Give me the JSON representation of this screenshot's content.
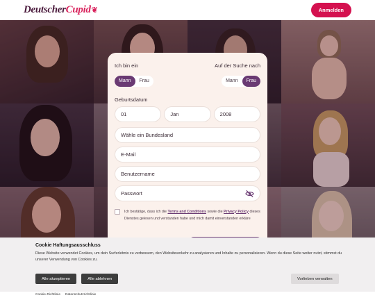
{
  "header": {
    "logo_part1": "Deutscher",
    "logo_part2": "Cupid",
    "login_label": "Anmelden"
  },
  "form": {
    "i_am_label": "Ich bin ein",
    "i_am_options": [
      "Mann",
      "Frau"
    ],
    "i_am_selected": "Mann",
    "seeking_label": "Auf der Suche nach",
    "seeking_options": [
      "Mann",
      "Frau"
    ],
    "seeking_selected": "Frau",
    "birthdate_label": "Geburtsdatum",
    "birth_day": "01",
    "birth_month": "Jan",
    "birth_year": "2008",
    "state_placeholder": "Wähle ein Bundesland",
    "email_placeholder": "E-Mail",
    "username_placeholder": "Benutzername",
    "password_placeholder": "Passwort",
    "consent_prefix": "Ich bestätige, dass ich die",
    "consent_terms_link": "Terms and Conditions",
    "consent_mid": "sowie die",
    "consent_privacy_link": "Privacy Policy",
    "consent_suffix": "dieses Dienstes gelesen und verstanden habe und mich damit einverstanden erkläre"
  },
  "cookie": {
    "title": "Cookie Haftungsausschluss",
    "text": "Diese Website verwendet Cookies, um dein Surferlebnis zu verbessern, den Websiteverkehr zu analysieren und Inhalte zu personalisieren. Wenn du diese Seite weiter nutzt, stimmst du unserer Verwendung von Cookies zu.",
    "accept_all": "Alle akzeptieren",
    "reject_all": "Alle ablehnen",
    "manage": "Vorlieben verwalten",
    "link_cookie": "Cookie-Richtlinie",
    "link_privacy": "Datenschutzrichtlinie"
  },
  "colors": {
    "brand": "#d4114f",
    "accent": "#6a3a73",
    "card_bg": "#fbf1ec"
  }
}
